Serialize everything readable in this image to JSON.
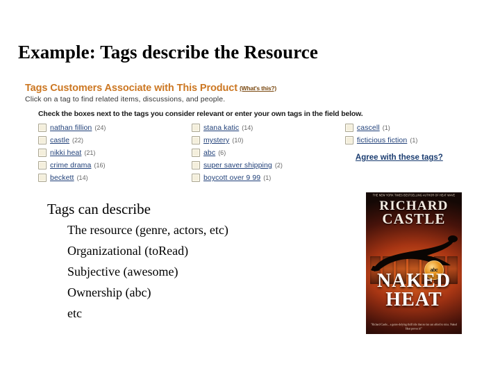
{
  "slide": {
    "title": "Example: Tags describe the Resource"
  },
  "tag_widget": {
    "heading": "Tags Customers Associate with This Product",
    "whats_this": "(What's this?)",
    "subtitle": "Click on a tag to find related items, discussions, and people.",
    "instruction": "Check the boxes next to the tags you consider relevant or enter your own tags in the field below.",
    "agree_link": "Agree with these tags?",
    "columns": [
      {
        "tags": [
          {
            "label": "nathan fillion",
            "count": "(24)"
          },
          {
            "label": "castle",
            "count": "(22)"
          },
          {
            "label": "nikki heat",
            "count": "(21)"
          },
          {
            "label": "crime drama",
            "count": "(16)"
          },
          {
            "label": "beckett",
            "count": "(14)"
          }
        ]
      },
      {
        "tags": [
          {
            "label": "stana katic",
            "count": "(14)"
          },
          {
            "label": "mystery",
            "count": "(10)"
          },
          {
            "label": "abc",
            "count": "(6)"
          },
          {
            "label": "super saver shipping",
            "count": "(2)"
          },
          {
            "label": "boycott over 9 99",
            "count": "(1)"
          }
        ]
      },
      {
        "tags": [
          {
            "label": "cascell",
            "count": "(1)"
          },
          {
            "label": "ficticious fiction",
            "count": "(1)"
          }
        ]
      }
    ]
  },
  "bullets": {
    "lead": "Tags can describe",
    "items": [
      "The resource (genre, actors, etc)",
      "Organizational (toRead)",
      "Subjective (awesome)",
      "Ownership (abc)",
      "etc"
    ]
  },
  "book_cover": {
    "tagline": "THE NEW YORK TIMES BESTSELLING AUTHOR OF HEAT WAVE",
    "author_line_1": "RICHARD",
    "author_line_2": "CASTLE",
    "title_line_1": "NAKED",
    "title_line_2": "HEAT",
    "badge": "abc",
    "blurb": "\"Richard Castle... a genre-defying thrill ride that no fan can afford to miss. Naked Heat proves it!\""
  },
  "colors": {
    "heading_orange": "#cc7722",
    "link_blue": "#1f3f78",
    "agree_blue": "#1a3c70",
    "checkbox_fill": "#f4efdc",
    "page_background": "#ffffff"
  }
}
